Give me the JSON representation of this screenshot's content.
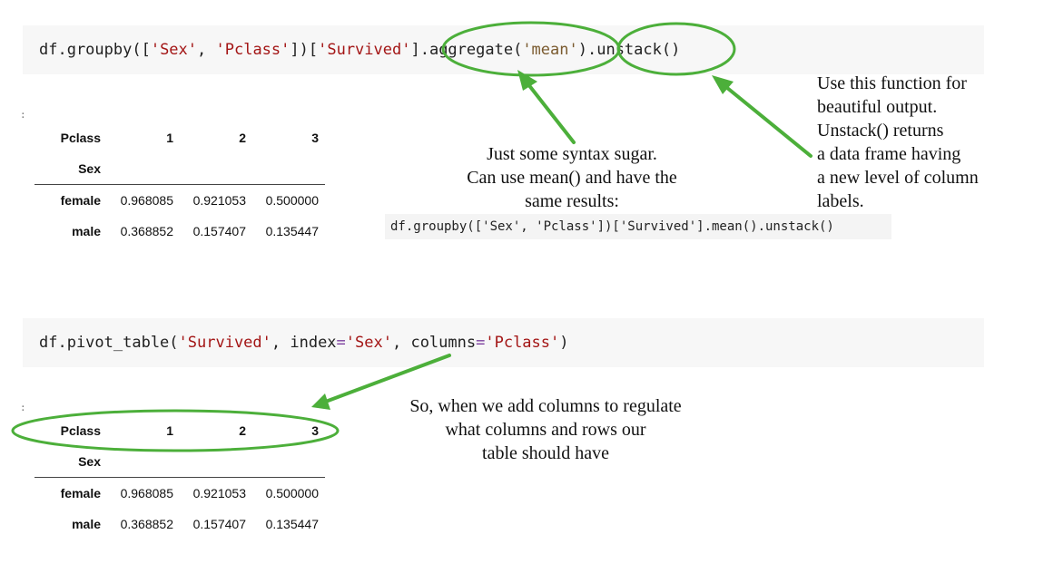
{
  "cell1": {
    "code_parts": {
      "p1": "df.groupby([",
      "s1": "'Sex'",
      "p2": ", ",
      "s2": "'Pclass'",
      "p3": "])[",
      "s3": "'Survived'",
      "p4": "]",
      "p5": ".aggregate(",
      "s4": "'mean'",
      "p6": ")",
      "p7": ".unstack()"
    },
    "prompt": ":"
  },
  "table1": {
    "columns_label": "Pclass",
    "columns": [
      "1",
      "2",
      "3"
    ],
    "index_label": "Sex",
    "rows": [
      {
        "label": "female",
        "values": [
          "0.968085",
          "0.921053",
          "0.500000"
        ]
      },
      {
        "label": "male",
        "values": [
          "0.368852",
          "0.157407",
          "0.135447"
        ]
      }
    ]
  },
  "note_syntax": {
    "line1": "Just some syntax sugar.",
    "line2": "Can use mean() and have the",
    "line3": "same results:"
  },
  "inline_code": "df.groupby(['Sex', 'Pclass'])['Survived'].mean().unstack()",
  "note_unstack": {
    "line1": "Use this function for",
    "line2": "beautiful  output.",
    "line3": "Unstack() returns",
    "line4": "a data frame having",
    "line5": "a new level of column",
    "line6": "labels."
  },
  "cell2": {
    "code_parts": {
      "p1": "df.pivot_table(",
      "s1": "'Survived'",
      "p2": ", index",
      "op1": "=",
      "s2": "'Sex'",
      "p3": ", columns",
      "op2": "=",
      "s3": "'Pclass'",
      "p4": ")"
    },
    "prompt": ":"
  },
  "table2": {
    "columns_label": "Pclass",
    "columns": [
      "1",
      "2",
      "3"
    ],
    "index_label": "Sex",
    "rows": [
      {
        "label": "female",
        "values": [
          "0.968085",
          "0.921053",
          "0.500000"
        ]
      },
      {
        "label": "male",
        "values": [
          "0.368852",
          "0.157407",
          "0.135447"
        ]
      }
    ]
  },
  "note_pivot": {
    "line1": "So, when we add columns to regulate",
    "line2": "what columns and rows our",
    "line3": "table should have"
  },
  "colors": {
    "annotation_green": "#4caf3a",
    "code_bg": "#f7f7f7",
    "string_red": "#a31515"
  }
}
